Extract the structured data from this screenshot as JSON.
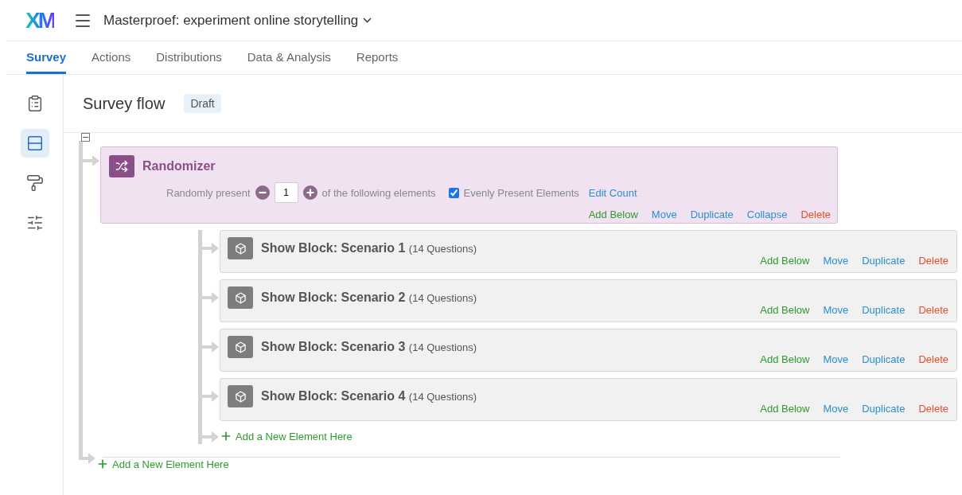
{
  "app": {
    "logo": "XM",
    "survey_title": "Masterproef: experiment online storytelling"
  },
  "tabs": [
    {
      "label": "Survey",
      "selected": true
    },
    {
      "label": "Actions",
      "selected": false
    },
    {
      "label": "Distributions",
      "selected": false
    },
    {
      "label": "Data & Analysis",
      "selected": false
    },
    {
      "label": "Reports",
      "selected": false
    }
  ],
  "rail": [
    {
      "kind": "clipboard",
      "selected": false
    },
    {
      "kind": "flow",
      "selected": true
    },
    {
      "kind": "roller",
      "selected": false
    },
    {
      "kind": "sliders",
      "selected": false
    }
  ],
  "page": {
    "title": "Survey flow",
    "status": "Draft"
  },
  "randomizer": {
    "title": "Randomizer",
    "expanded": true,
    "prefix": "Randomly present",
    "count": "1",
    "suffix": "of the following elements",
    "evenly": {
      "label": "Evenly Present Elements",
      "checked": true
    },
    "edit_count": "Edit Count",
    "actions": [
      {
        "label": "Add Below",
        "kind": "add"
      },
      {
        "label": "Move",
        "kind": "normal"
      },
      {
        "label": "Duplicate",
        "kind": "normal"
      },
      {
        "label": "Collapse",
        "kind": "normal"
      },
      {
        "label": "Delete",
        "kind": "delete"
      }
    ]
  },
  "children": [
    {
      "title": "Show Block: Scenario 1",
      "detail": "(14 Questions)",
      "actions": [
        {
          "label": "Add Below",
          "kind": "add"
        },
        {
          "label": "Move",
          "kind": "normal"
        },
        {
          "label": "Duplicate",
          "kind": "normal"
        },
        {
          "label": "Delete",
          "kind": "delete"
        }
      ]
    },
    {
      "title": "Show Block: Scenario 2",
      "detail": "(14 Questions)",
      "actions": [
        {
          "label": "Add Below",
          "kind": "add"
        },
        {
          "label": "Move",
          "kind": "normal"
        },
        {
          "label": "Duplicate",
          "kind": "normal"
        },
        {
          "label": "Delete",
          "kind": "delete"
        }
      ]
    },
    {
      "title": "Show Block: Scenario 3",
      "detail": "(14 Questions)",
      "actions": [
        {
          "label": "Add Below",
          "kind": "add"
        },
        {
          "label": "Move",
          "kind": "normal"
        },
        {
          "label": "Duplicate",
          "kind": "normal"
        },
        {
          "label": "Delete",
          "kind": "delete"
        }
      ]
    },
    {
      "title": "Show Block: Scenario 4",
      "detail": "(14 Questions)",
      "actions": [
        {
          "label": "Add Below",
          "kind": "add"
        },
        {
          "label": "Move",
          "kind": "normal"
        },
        {
          "label": "Duplicate",
          "kind": "normal"
        },
        {
          "label": "Delete",
          "kind": "delete"
        }
      ]
    }
  ],
  "add_child": "Add a New Element Here",
  "add_root": "Add a New Element Here"
}
